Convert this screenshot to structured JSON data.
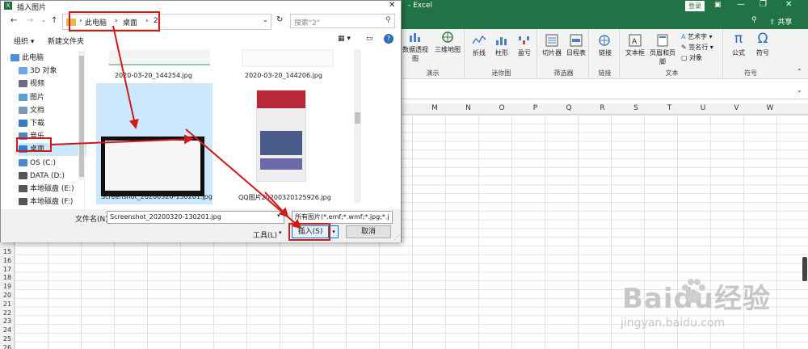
{
  "excel": {
    "title": "- Excel",
    "login": "登录",
    "share": "共享",
    "tabs": [],
    "ribbon": {
      "groups": [
        {
          "label": "演示",
          "items": [
            "数据透视图",
            "三维地图"
          ]
        },
        {
          "label": "迷你图",
          "items": [
            "折线",
            "柱形",
            "盈亏"
          ]
        },
        {
          "label": "筛选器",
          "items": [
            "切片器",
            "日程表"
          ]
        },
        {
          "label": "链接",
          "items": [
            "链接"
          ]
        },
        {
          "label": "文本",
          "items": [
            "文本框",
            "页眉和页脚",
            "艺术字",
            "签名行",
            "对象"
          ]
        },
        {
          "label": "符号",
          "items": [
            "公式",
            "符号"
          ]
        }
      ]
    },
    "columns": [
      "M",
      "N",
      "O",
      "P",
      "Q",
      "R",
      "S",
      "T",
      "U",
      "V",
      "W"
    ],
    "rows": [
      "15",
      "16",
      "17",
      "18",
      "19",
      "20",
      "21",
      "22",
      "23",
      "24",
      "25",
      "26"
    ]
  },
  "dialog": {
    "title": "插入图片",
    "breadcrumb": [
      "此电脑",
      "桌面",
      "2"
    ],
    "search_placeholder": "搜索\"2\"",
    "organize": "组织 ▾",
    "new_folder": "新建文件夹",
    "nav_items": [
      {
        "label": "此电脑",
        "color": "#4a90d9"
      },
      {
        "label": "3D 对象",
        "color": "#6aa8e8"
      },
      {
        "label": "视频",
        "color": "#6a6a8a"
      },
      {
        "label": "图片",
        "color": "#5aa0d0"
      },
      {
        "label": "文档",
        "color": "#7a9ab8"
      },
      {
        "label": "下载",
        "color": "#3a7ac8"
      },
      {
        "label": "音乐",
        "color": "#4a86c8"
      },
      {
        "label": "桌面",
        "color": "#2f7fd6"
      },
      {
        "label": "OS (C:)",
        "color": "#4a8ad0"
      },
      {
        "label": "DATA (D:)",
        "color": "#555"
      },
      {
        "label": "本地磁盘 (E:)",
        "color": "#555"
      },
      {
        "label": "本地磁盘 (F:)",
        "color": "#555"
      }
    ],
    "files": [
      {
        "name": "2020-03-20_144254.jpg"
      },
      {
        "name": "2020-03-20_144206.jpg"
      },
      {
        "name": "Screenshot_20200320-130201.jpg"
      },
      {
        "name": "QQ图片20200320125926.jpg"
      }
    ],
    "filename_label": "文件名(N):",
    "filename_value": "Screenshot_20200320-130201.jpg",
    "filter_value": "所有图片(*.emf;*.wmf;*.jpg;*.j",
    "tools": "工具(L)",
    "insert": "插入(S)",
    "cancel": "取消"
  },
  "watermark": {
    "brand": "Baidu经验",
    "url": "jingyan.baidu.com"
  },
  "colors": {
    "excel_green": "#217346",
    "annotation_red": "#d11a1a",
    "selection_blue": "#cce8ff"
  }
}
